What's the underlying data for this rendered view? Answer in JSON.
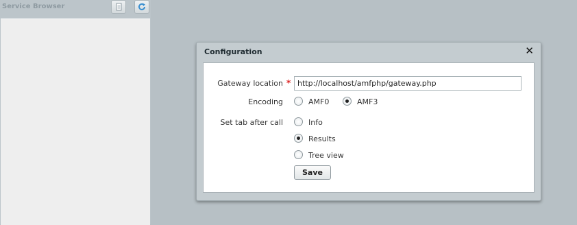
{
  "panel": {
    "title": "Service Browser"
  },
  "dialog": {
    "title": "Configuration",
    "close_symbol": "✕",
    "gateway": {
      "label": "Gateway location",
      "required_mark": "*",
      "value": "http://localhost/amfphp/gateway.php"
    },
    "encoding": {
      "label": "Encoding",
      "options": [
        "AMF0",
        "AMF3"
      ],
      "selected": "AMF3"
    },
    "tab_after_call": {
      "label": "Set tab after call",
      "options": [
        "Info",
        "Results",
        "Tree view"
      ],
      "selected": "Results"
    },
    "save_label": "Save"
  },
  "icons": {
    "toolbar_button_1": "document-icon",
    "toolbar_button_2": "refresh-icon",
    "close": "close-icon"
  }
}
